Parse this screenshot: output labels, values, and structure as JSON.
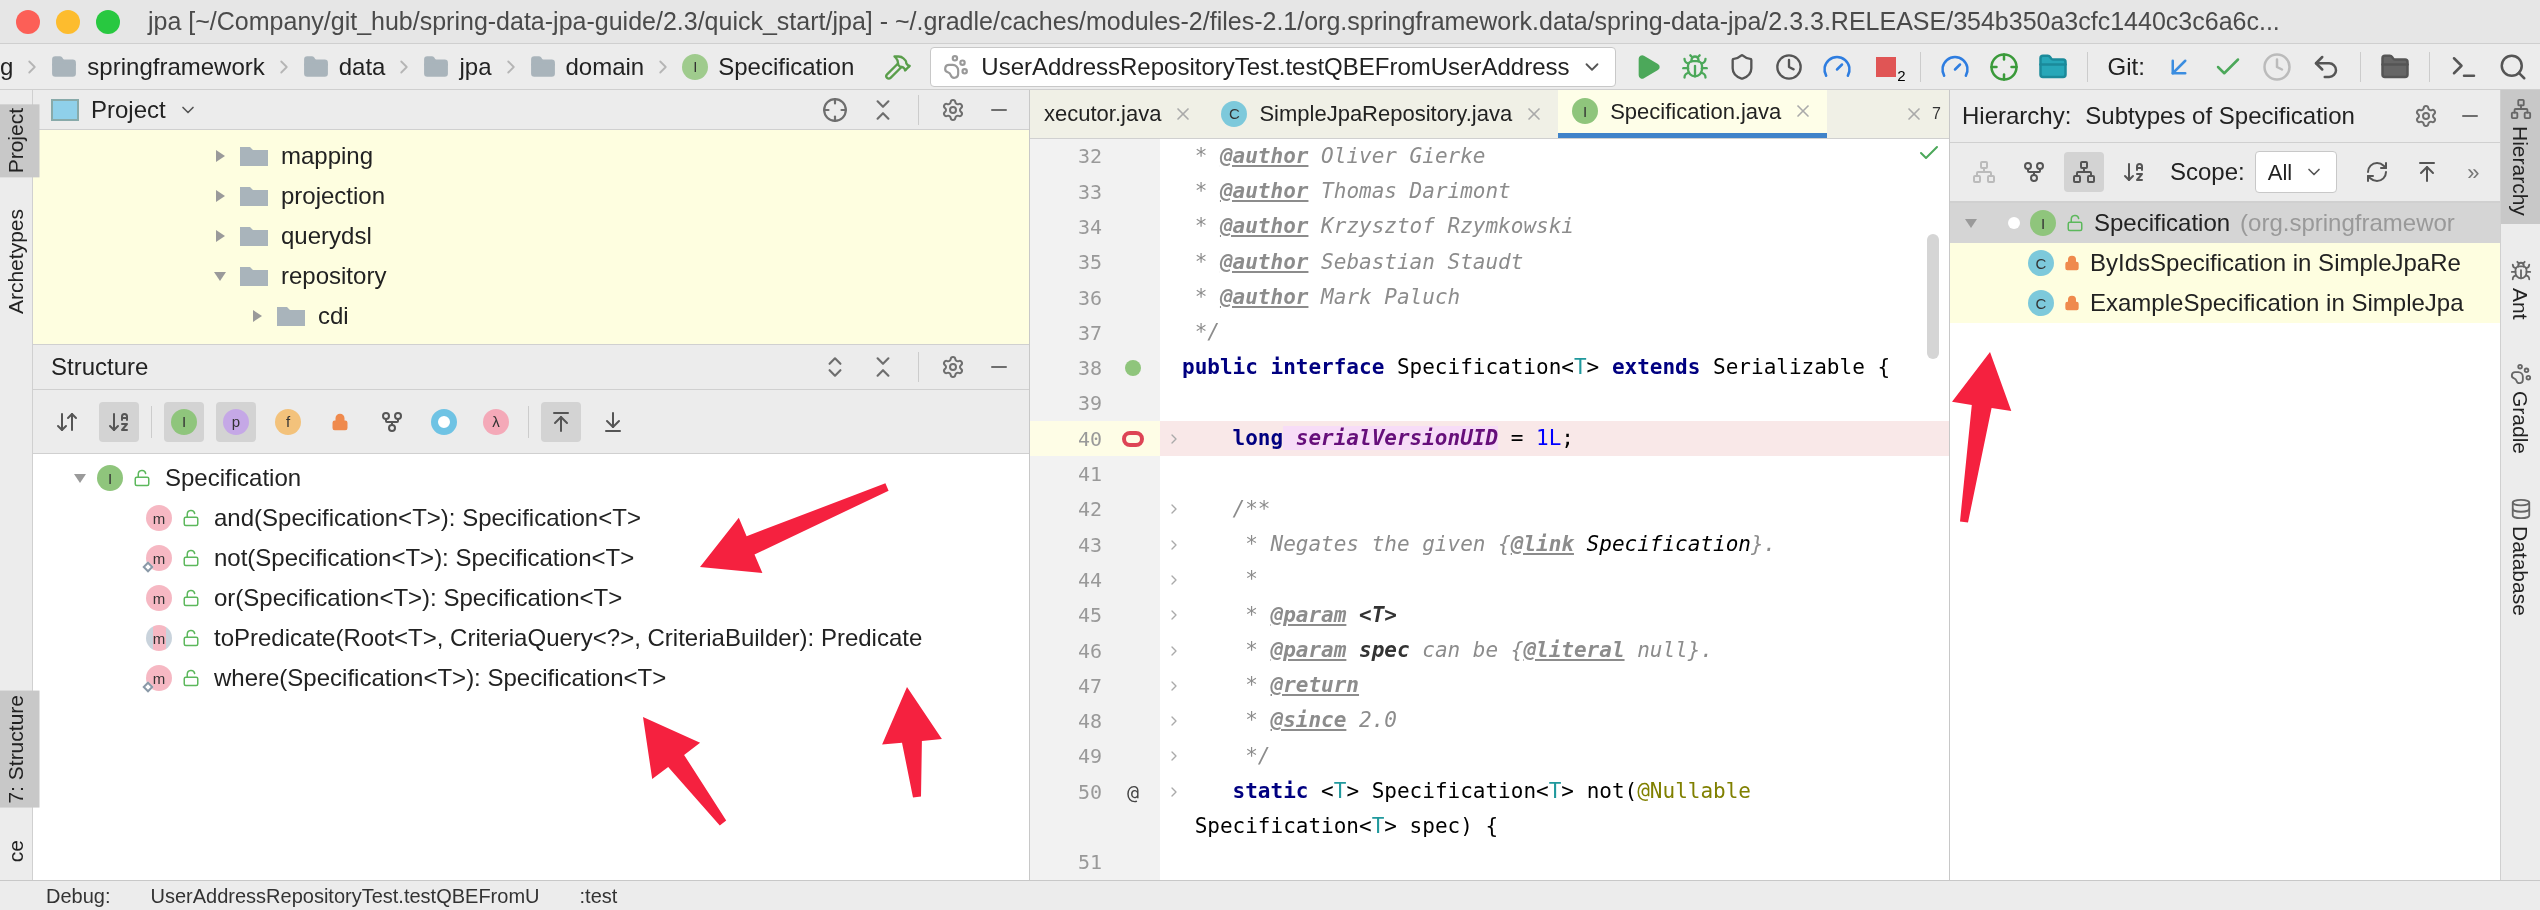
{
  "window": {
    "title": "jpa [~/Company/git_hub/spring-data-jpa-guide/2.3/quick_start/jpa] - ~/.gradle/caches/modules-2/files-2.1/org.springframework.data/spring-data-jpa/2.3.3.RELEASE/354b350a3cfc1440c3c6a6c..."
  },
  "breadcrumbs": [
    {
      "label": "g",
      "kind": "none"
    },
    {
      "label": "springframework",
      "kind": "folder"
    },
    {
      "label": "data",
      "kind": "folder"
    },
    {
      "label": "jpa",
      "kind": "folder"
    },
    {
      "label": "domain",
      "kind": "folder"
    },
    {
      "label": "Specification",
      "kind": "interface",
      "glyph": "I"
    }
  ],
  "run_config": {
    "value": "UserAddressRepositoryTest.testQBEFromUserAddress"
  },
  "stop_badge": "2",
  "git_label": "Git:",
  "left_strip": [
    {
      "label": "Project",
      "selected": true
    },
    {
      "label": "Archetypes",
      "selected": false
    },
    {
      "label": "7: Structure",
      "selected": true
    },
    {
      "label": "ce",
      "selected": false
    }
  ],
  "project": {
    "title": "Project",
    "tree": [
      {
        "label": "mapping",
        "expanded": false
      },
      {
        "label": "projection",
        "expanded": false
      },
      {
        "label": "querydsl",
        "expanded": false
      },
      {
        "label": "repository",
        "expanded": true,
        "children": [
          {
            "label": "cdi",
            "expanded": false
          }
        ]
      }
    ]
  },
  "structure": {
    "title": "Structure",
    "toolbar": [
      {
        "kind": "sort-visibility",
        "on": false
      },
      {
        "kind": "sort-alpha",
        "on": true
      },
      {
        "kind": "badge",
        "glyph": "I",
        "color": "#8fc57c",
        "on": true
      },
      {
        "kind": "badge",
        "glyph": "p",
        "color": "#c5a8e6",
        "on": true
      },
      {
        "kind": "badge",
        "glyph": "f",
        "color": "#f3c27b",
        "on": false
      },
      {
        "kind": "lock",
        "on": false
      },
      {
        "kind": "fork",
        "on": false
      },
      {
        "kind": "ring",
        "on": false
      },
      {
        "kind": "badge",
        "glyph": "λ",
        "color": "#f4a9b8",
        "on": false
      },
      {
        "kind": "scroll-from",
        "on": true
      },
      {
        "kind": "scroll-to",
        "on": false
      }
    ],
    "root": {
      "label": "Specification",
      "glyph": "I",
      "expanded": true,
      "children": [
        {
          "label": "and(Specification<T>): Specification<T>",
          "glyph": "m",
          "overrides": false,
          "abstract": false
        },
        {
          "label": "not(Specification<T>): Specification<T>",
          "glyph": "m",
          "overrides": true,
          "abstract": false
        },
        {
          "label": "or(Specification<T>): Specification<T>",
          "glyph": "m",
          "overrides": false,
          "abstract": false
        },
        {
          "label": "toPredicate(Root<T>, CriteriaQuery<?>, CriteriaBuilder): Predicate",
          "glyph": "m",
          "overrides": false,
          "abstract": true
        },
        {
          "label": "where(Specification<T>): Specification<T>",
          "glyph": "m",
          "overrides": true,
          "abstract": false
        }
      ]
    }
  },
  "editor": {
    "tabs": [
      {
        "label": "xecutor.java",
        "kind": "plain",
        "selected": false
      },
      {
        "label": "SimpleJpaRepository.java",
        "kind": "class",
        "glyph": "C",
        "selected": false
      },
      {
        "label": "Specification.java",
        "kind": "interface",
        "glyph": "I",
        "selected": true
      }
    ],
    "tab_count": "7",
    "lines": [
      {
        "number": "32",
        "kind": "plain",
        "current": false,
        "fold": false,
        "segments": [
          {
            "kind": "comment",
            "text": " * "
          },
          {
            "kind": "tag",
            "text": "@author"
          },
          {
            "kind": "comment",
            "text": " Oliver Gierke"
          }
        ]
      },
      {
        "number": "33",
        "kind": "plain",
        "current": false,
        "fold": false,
        "segments": [
          {
            "kind": "comment",
            "text": " * "
          },
          {
            "kind": "tag",
            "text": "@author"
          },
          {
            "kind": "comment",
            "text": " Thomas Darimont"
          }
        ]
      },
      {
        "number": "34",
        "kind": "plain",
        "current": false,
        "fold": false,
        "segments": [
          {
            "kind": "comment",
            "text": " * "
          },
          {
            "kind": "tag",
            "text": "@author"
          },
          {
            "kind": "comment",
            "text": " Krzysztof Rzymkowski"
          }
        ]
      },
      {
        "number": "35",
        "kind": "plain",
        "current": false,
        "fold": false,
        "segments": [
          {
            "kind": "comment",
            "text": " * "
          },
          {
            "kind": "tag",
            "text": "@author"
          },
          {
            "kind": "comment",
            "text": " Sebastian Staudt"
          }
        ]
      },
      {
        "number": "36",
        "kind": "plain",
        "current": false,
        "fold": false,
        "segments": [
          {
            "kind": "comment",
            "text": " * "
          },
          {
            "kind": "tag",
            "text": "@author"
          },
          {
            "kind": "comment",
            "text": " Mark Paluch"
          }
        ]
      },
      {
        "number": "37",
        "kind": "plain",
        "current": false,
        "fold": false,
        "segments": [
          {
            "kind": "comment",
            "text": " */"
          }
        ]
      },
      {
        "number": "38",
        "kind": "implemented",
        "current": false,
        "fold": false,
        "segments": [
          {
            "kind": "keyword",
            "text": "public interface"
          },
          {
            "kind": "plain",
            "text": " Specification<"
          },
          {
            "kind": "typeparam",
            "text": "T"
          },
          {
            "kind": "plain",
            "text": "> "
          },
          {
            "kind": "keyword",
            "text": "extends"
          },
          {
            "kind": "plain",
            "text": " Serializable {"
          }
        ]
      },
      {
        "number": "39",
        "kind": "plain",
        "current": false,
        "fold": false
      },
      {
        "number": "40",
        "kind": "breakpoint",
        "current": true,
        "fold": true,
        "segments": [
          {
            "kind": "keyword",
            "text": "    long"
          },
          {
            "kind": "field",
            "text": " serialVersionUID"
          },
          {
            "kind": "plain",
            "text": " = "
          },
          {
            "kind": "number",
            "text": "1L"
          },
          {
            "kind": "plain",
            "text": ";"
          }
        ]
      },
      {
        "number": "41",
        "kind": "plain",
        "current": false,
        "fold": false
      },
      {
        "number": "42",
        "kind": "plain",
        "current": false,
        "fold": true,
        "segments": [
          {
            "kind": "comment",
            "text": "    /**"
          }
        ]
      },
      {
        "number": "43",
        "kind": "plain",
        "current": false,
        "fold": true,
        "segments": [
          {
            "kind": "comment",
            "text": "     * Negates the given {"
          },
          {
            "kind": "tag",
            "text": "@link"
          },
          {
            "kind": "link",
            "text": " Specification"
          },
          {
            "kind": "comment",
            "text": "}."
          }
        ]
      },
      {
        "number": "44",
        "kind": "plain",
        "current": false,
        "fold": true,
        "segments": [
          {
            "kind": "comment",
            "text": "     *"
          }
        ]
      },
      {
        "number": "45",
        "kind": "plain",
        "current": false,
        "fold": true,
        "segments": [
          {
            "kind": "comment",
            "text": "     * "
          },
          {
            "kind": "tag",
            "text": "@param"
          },
          {
            "kind": "docbold",
            "text": " <T>"
          }
        ]
      },
      {
        "number": "46",
        "kind": "plain",
        "current": false,
        "fold": true,
        "segments": [
          {
            "kind": "comment",
            "text": "     * "
          },
          {
            "kind": "tag",
            "text": "@param"
          },
          {
            "kind": "docbold",
            "text": " spec"
          },
          {
            "kind": "comment",
            "text": " can be {"
          },
          {
            "kind": "tag",
            "text": "@literal"
          },
          {
            "kind": "comment",
            "text": " null}."
          }
        ]
      },
      {
        "number": "47",
        "kind": "plain",
        "current": false,
        "fold": true,
        "segments": [
          {
            "kind": "comment",
            "text": "     * "
          },
          {
            "kind": "tag",
            "text": "@return"
          }
        ]
      },
      {
        "number": "48",
        "kind": "plain",
        "current": false,
        "fold": true,
        "segments": [
          {
            "kind": "comment",
            "text": "     * "
          },
          {
            "kind": "tag",
            "text": "@since"
          },
          {
            "kind": "comment",
            "text": " 2.0"
          }
        ]
      },
      {
        "number": "49",
        "kind": "plain",
        "current": false,
        "fold": true,
        "segments": [
          {
            "kind": "comment",
            "text": "     */"
          }
        ]
      },
      {
        "number": "50",
        "kind": "plain",
        "current": false,
        "fold": true,
        "gutter_text": "@",
        "segments": [
          {
            "kind": "keyword",
            "text": "    static"
          },
          {
            "kind": "plain",
            "text": " <"
          },
          {
            "kind": "typeparam",
            "text": "T"
          },
          {
            "kind": "plain",
            "text": "> Specification<"
          },
          {
            "kind": "typeparam",
            "text": "T"
          },
          {
            "kind": "plain",
            "text": "> not("
          },
          {
            "kind": "annotation",
            "text": "@Nullable"
          }
        ]
      },
      {
        "kind": "plain",
        "current": false,
        "fold": false,
        "segments": [
          {
            "kind": "plain",
            "text": " Specification<"
          },
          {
            "kind": "typeparam",
            "text": "T"
          },
          {
            "kind": "plain",
            "text": "> spec) {"
          }
        ]
      },
      {
        "number": "51",
        "kind": "plain",
        "current": false,
        "fold": false
      }
    ]
  },
  "hierarchy": {
    "title": "Hierarchy:",
    "subtitle": "Subtypes of Specification",
    "toolbar": [
      {
        "kind": "supertypes",
        "on": false
      },
      {
        "kind": "subtypes",
        "on": false
      },
      {
        "kind": "type-hierarchy",
        "on": true
      },
      {
        "kind": "sort-alpha",
        "on": false
      }
    ],
    "scope_label": "Scope:",
    "scope": "All",
    "more": "»",
    "root": {
      "label": "Specification",
      "qualifier": "(org.springframewor",
      "glyph": "I",
      "selected": true,
      "expanded": true,
      "children": [
        {
          "label": "ByIdsSpecification in SimpleJpaRe",
          "glyph": "C"
        },
        {
          "label": "ExampleSpecification in SimpleJpa",
          "glyph": "C"
        }
      ]
    }
  },
  "right_strip": [
    {
      "label": "Hierarchy",
      "selected": true,
      "kind": "hierarchy"
    },
    {
      "label": "Ant",
      "selected": false,
      "kind": "ant"
    },
    {
      "label": "Gradle",
      "selected": false,
      "kind": "gradle"
    },
    {
      "label": "Database",
      "selected": false,
      "kind": "database"
    }
  ],
  "bottom_bar": {
    "label": "Debug:",
    "tabs": [
      "UserAddressRepositoryTest.testQBEFromU",
      ":test"
    ]
  },
  "annotations": [
    {
      "kind": "arrow"
    },
    {
      "kind": "arrow"
    },
    {
      "kind": "arrow"
    },
    {
      "kind": "arrow"
    }
  ]
}
